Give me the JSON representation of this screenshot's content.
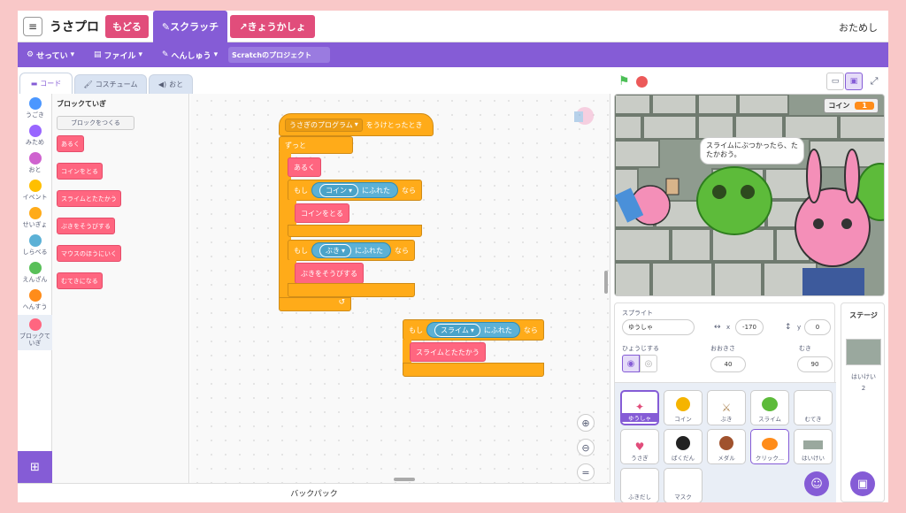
{
  "header": {
    "menu_icon": "hamburger-icon",
    "title": "うさプロ",
    "back": "もどる",
    "scratch": "スクラッチ",
    "textbook": "きょうかしょ",
    "trial": "おためし"
  },
  "menubar": {
    "settings": "せってい",
    "file": "ファイル",
    "edit": "へんしゅう",
    "project": "Scratchのプロジェクト"
  },
  "tabs": [
    "コード",
    "コスチューム",
    "おと"
  ],
  "categories": [
    {
      "label": "うごき",
      "color": "#4c97ff"
    },
    {
      "label": "みため",
      "color": "#9966ff"
    },
    {
      "label": "おと",
      "color": "#cf63cf"
    },
    {
      "label": "イベント",
      "color": "#ffbf00"
    },
    {
      "label": "せいぎょ",
      "color": "#ffab19"
    },
    {
      "label": "しらべる",
      "color": "#5cb1d6"
    },
    {
      "label": "えんざん",
      "color": "#59c059"
    },
    {
      "label": "へんすう",
      "color": "#ff8c1a"
    },
    {
      "label": "ブロックていぎ",
      "color": "#ff6680"
    }
  ],
  "palette": {
    "title": "ブロックていぎ",
    "make_block": "ブロックをつくる",
    "blocks": [
      "あるく",
      "コインをとる",
      "スライムとたたかう",
      "ぶきをそうびする",
      "マウスのほうにいく",
      "むてきになる"
    ]
  },
  "script1": {
    "hat_drop": "うさぎのプログラム",
    "hat_text": "をうけとったとき",
    "forever": "ずっと",
    "walk": "あるく",
    "if1": "もし",
    "if1_drop": "コイン",
    "touch": "にふれた",
    "then": "なら",
    "get_coin": "コインをとる",
    "if2": "もし",
    "if2_drop": "ぶき",
    "equip": "ぶきをそうびする"
  },
  "script2": {
    "if": "もし",
    "drop": "スライム",
    "touch": "にふれた",
    "then": "なら",
    "fight": "スライムとたたかう"
  },
  "backpack": "バックパック",
  "stage": {
    "monitor_label": "コイン",
    "monitor_value": "1",
    "bubble": "スライムにぶつかったら、たたかおう。"
  },
  "sprite_info": {
    "sprite_label": "スプライト",
    "name": "ゆうしゃ",
    "x_label": "x",
    "x": "-170",
    "y_label": "y",
    "y": "0",
    "show_label": "ひょうじする",
    "size_label": "おおきさ",
    "size": "40",
    "dir_label": "むき",
    "dir": "90"
  },
  "sprites": [
    "ゆうしゃ",
    "コイン",
    "ぶき",
    "スライム",
    "むてき",
    "うさぎ",
    "ばくだん",
    "メダル",
    "クリック...",
    "はいけい",
    "ふきだし",
    "マスク"
  ],
  "stage_panel": {
    "title": "ステージ",
    "backdrop_label": "はいけい",
    "backdrop_count": "2"
  }
}
